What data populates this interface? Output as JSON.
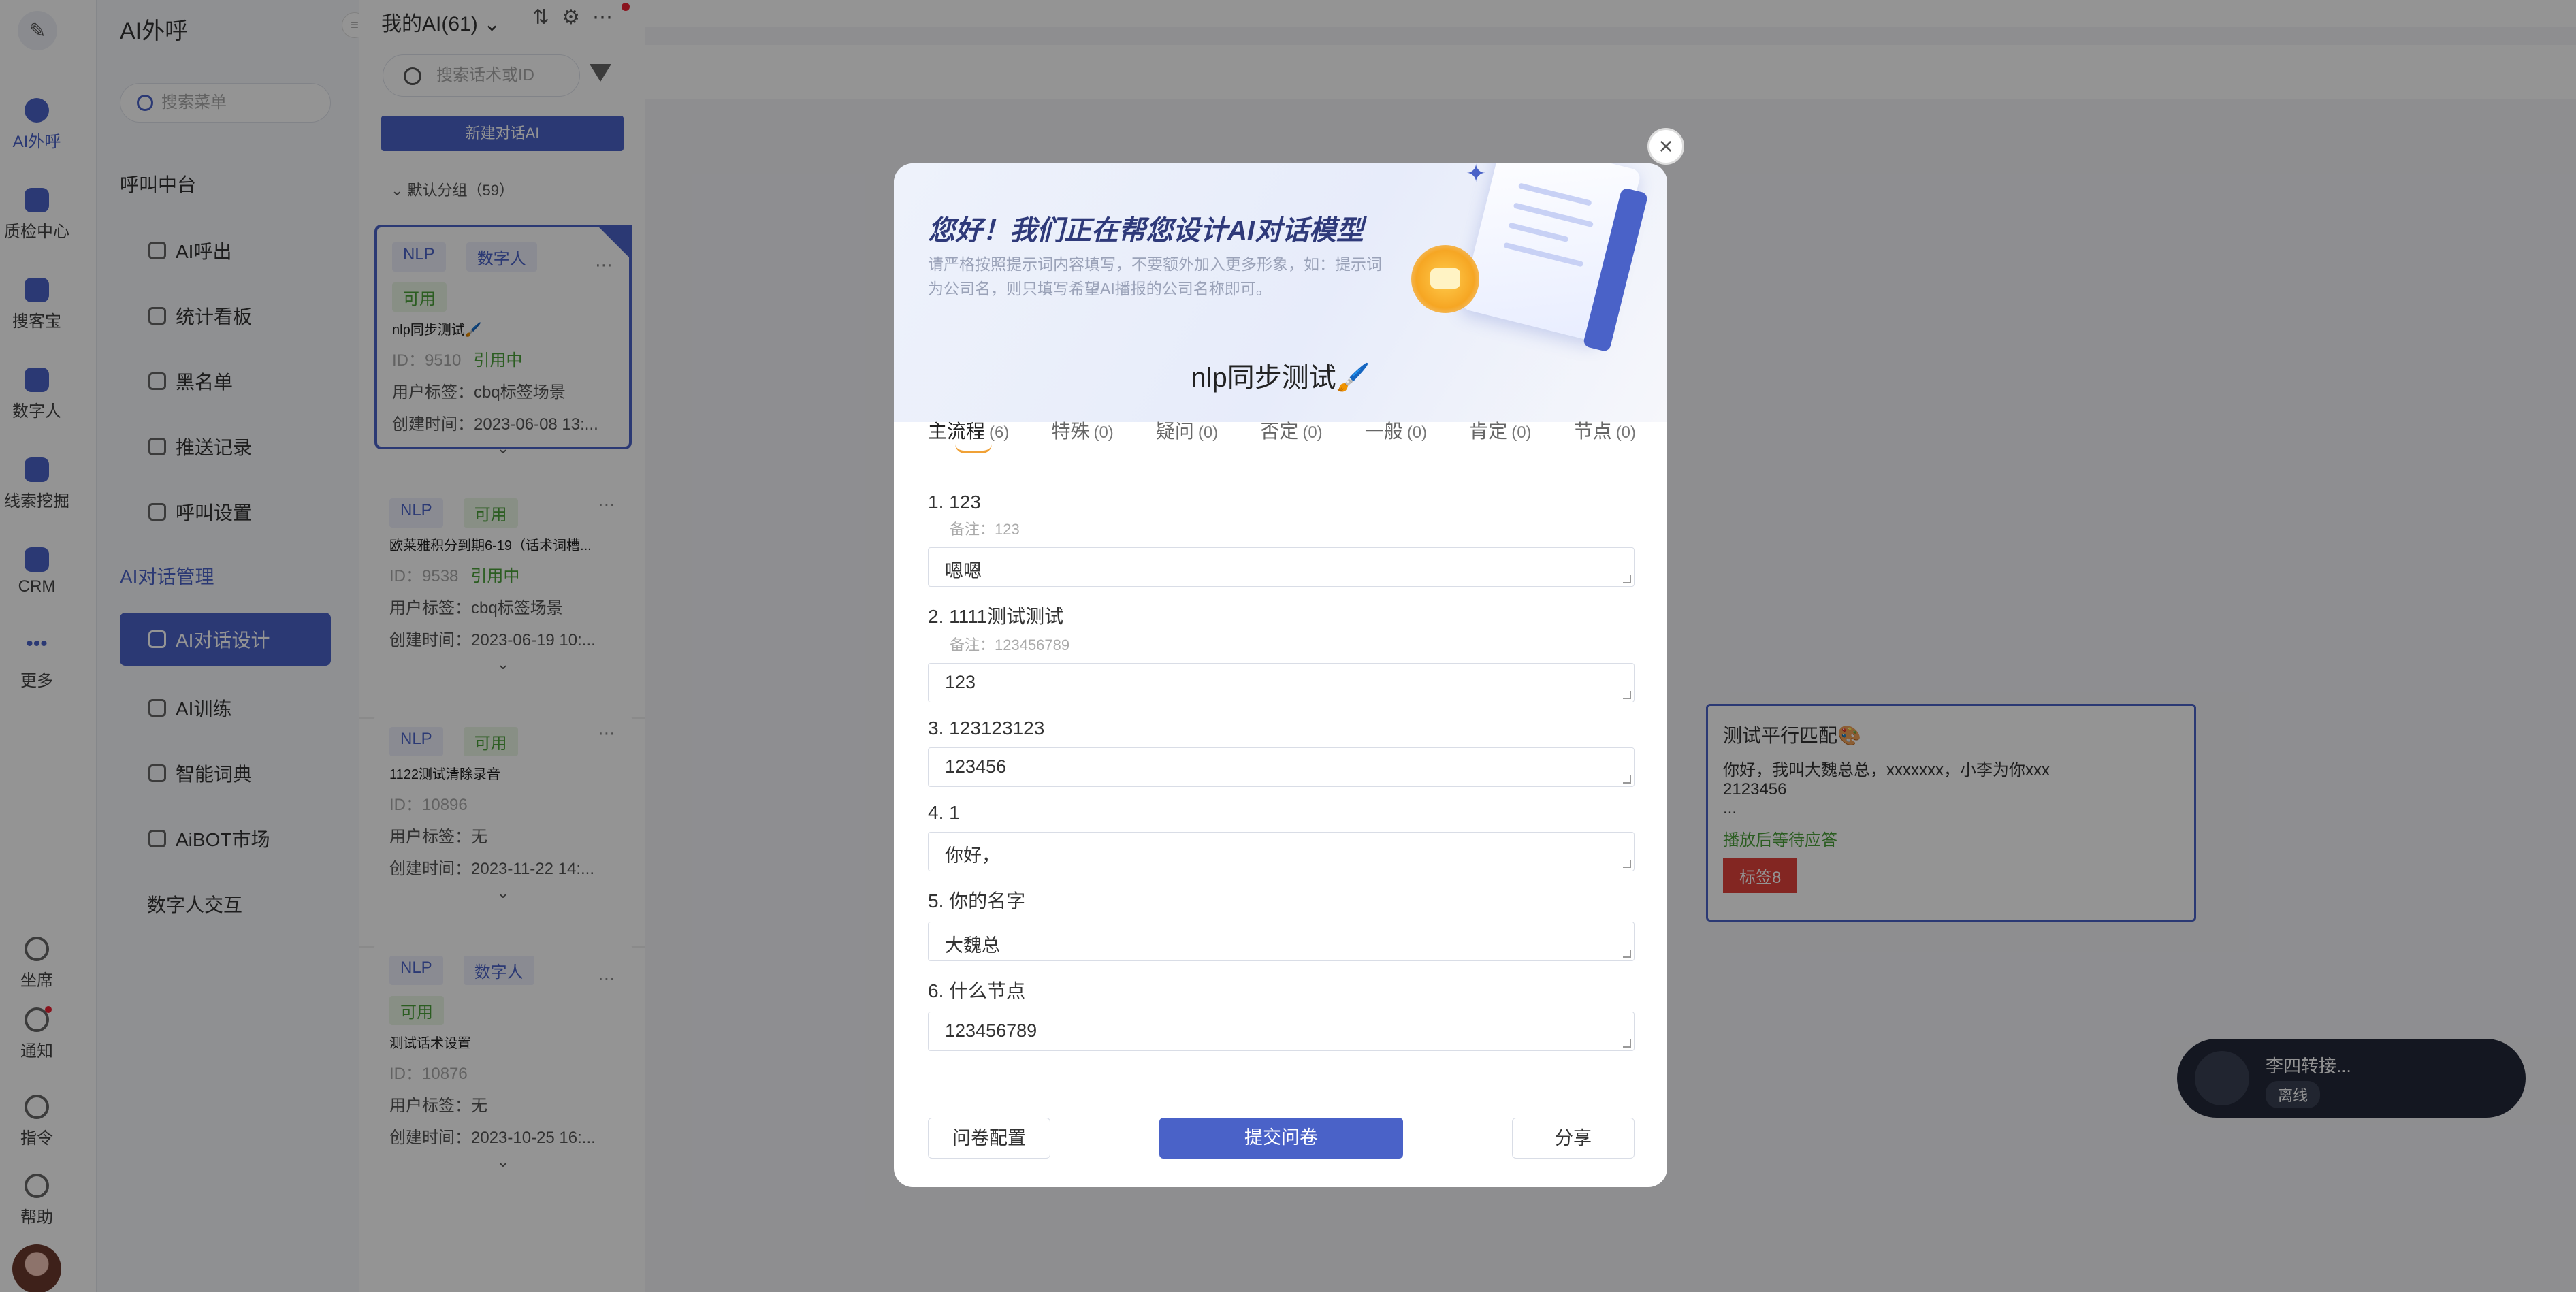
{
  "rail": {
    "items": [
      {
        "label": "AI外呼",
        "active": true
      },
      {
        "label": "质检中心"
      },
      {
        "label": "搜客宝"
      },
      {
        "label": "数字人"
      },
      {
        "label": "线索挖掘"
      },
      {
        "label": "CRM"
      },
      {
        "label": "更多"
      },
      {
        "label": "坐席"
      },
      {
        "label": "通知"
      },
      {
        "label": "指令"
      },
      {
        "label": "帮助"
      }
    ]
  },
  "menu": {
    "title": "AI外呼",
    "search_placeholder": "搜索菜单",
    "group1": "呼叫中台",
    "items1": [
      "AI呼出",
      "统计看板",
      "黑名单",
      "推送记录",
      "呼叫设置"
    ],
    "group2": "AI对话管理",
    "items2": [
      "AI对话设计",
      "AI训练",
      "智能词典",
      "AiBOT市场",
      "数字人交互"
    ]
  },
  "list": {
    "header": "我的AI(61)",
    "search_placeholder": "搜索话术或ID",
    "new_button": "新建对话AI",
    "group": "默认分组（59）",
    "cards": [
      {
        "tags": [
          "NLP",
          "数字人",
          "可用"
        ],
        "name": "nlp同步测试🖌️",
        "id": "ID：9510",
        "status": "引用中",
        "user_tag": "用户标签：cbq标签场景",
        "created": "创建时间：2023-06-08 13:..."
      },
      {
        "tags": [
          "NLP",
          "可用"
        ],
        "name": "欧莱雅积分到期6-19（话术词槽...",
        "id": "ID：9538",
        "status": "引用中",
        "user_tag": "用户标签：cbq标签场景",
        "created": "创建时间：2023-06-19 10:..."
      },
      {
        "tags": [
          "NLP",
          "可用"
        ],
        "name": "1122测试清除录音",
        "id": "ID：10896",
        "status": "",
        "user_tag": "用户标签：无",
        "created": "创建时间：2023-11-22 14:..."
      },
      {
        "tags": [
          "NLP",
          "数字人",
          "可用"
        ],
        "name": "测试话术设置",
        "id": "ID：10876",
        "status": "",
        "user_tag": "用户标签：无",
        "created": "创建时间：2023-10-25 16:..."
      }
    ]
  },
  "canvas": {
    "node_title": "测试平行匹配🎨",
    "node_text": "你好，我叫大魏总总，xxxxxxx，小李为你xxx",
    "node_text2": "2123456",
    "node_ellipsis": "...",
    "node_status": "播放后等待应答",
    "node_tag": "标签8"
  },
  "phone": {
    "name": "李四转接...",
    "status": "离线"
  },
  "modal": {
    "hero_title": "您好！我们正在帮您设计AI对话模型",
    "hero_subtitle": "请严格按照提示词内容填写，不要额外加入更多形象，如：提示词为公司名，则只填写希望AI播报的公司名称即可。",
    "script_name": "nlp同步测试🖌️",
    "tabs": [
      {
        "label": "主流程",
        "count": "(6)",
        "active": true
      },
      {
        "label": "特殊",
        "count": "(0)"
      },
      {
        "label": "疑问",
        "count": "(0)"
      },
      {
        "label": "否定",
        "count": "(0)"
      },
      {
        "label": "一般",
        "count": "(0)"
      },
      {
        "label": "肯定",
        "count": "(0)"
      },
      {
        "label": "节点",
        "count": "(0)"
      }
    ],
    "questions": [
      {
        "title": "1. 123",
        "note": "备注：123",
        "answer": "嗯嗯"
      },
      {
        "title": "2. 1111测试测试",
        "note": "备注：123456789",
        "answer": "123"
      },
      {
        "title": "3. 123123123",
        "note": "",
        "answer": "123456"
      },
      {
        "title": "4. 1",
        "note": "",
        "answer": "你好，"
      },
      {
        "title": "5. 你的名字",
        "note": "",
        "answer": "大魏总"
      },
      {
        "title": "6. 什么节点",
        "note": "",
        "answer": "123456789"
      }
    ],
    "btn_config": "问卷配置",
    "btn_submit": "提交问卷",
    "btn_share": "分享",
    "close": "×"
  },
  "colors": {
    "accent": "#4a62c8",
    "success": "#4aa13a",
    "danger": "#e2433c"
  }
}
